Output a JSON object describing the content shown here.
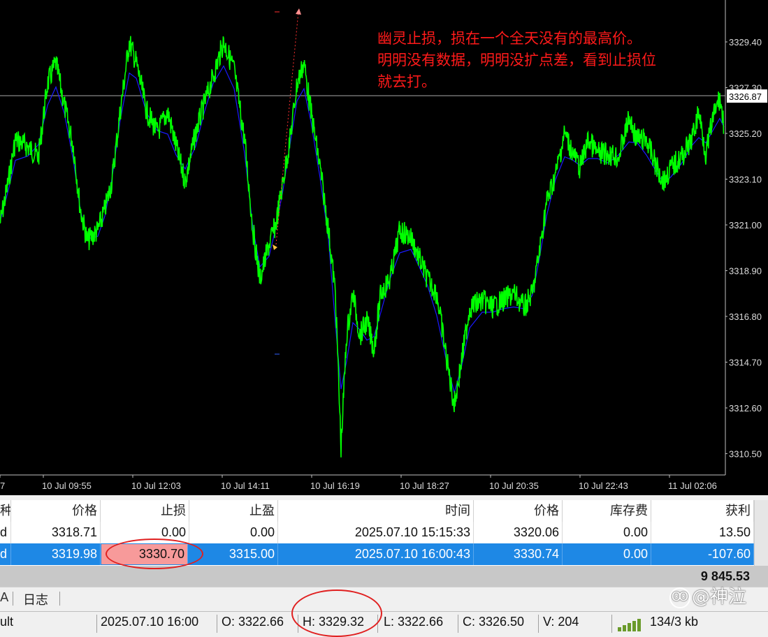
{
  "chart": {
    "annotation_lines": [
      "幽灵止损，损在一个全天没有的最高价。",
      "明明没有数据，明明没扩点差，看到止损位",
      "就去打。"
    ],
    "price_axis": [
      "3329.40",
      "3327.30",
      "3325.20",
      "3323.10",
      "3321.00",
      "3318.90",
      "3316.80",
      "3314.70",
      "3312.60",
      "3310.50"
    ],
    "current_price": "3326.87",
    "time_axis": [
      "7",
      "10 Jul 09:55",
      "10 Jul 12:03",
      "10 Jul 14:11",
      "10 Jul 16:19",
      "10 Jul 18:27",
      "10 Jul 20:35",
      "10 Jul 22:43",
      "11 Jul 02:06"
    ],
    "price_line_color": "#00ff00",
    "ma_line_color": "#1a1aff",
    "background_color": "#000000"
  },
  "orders_table": {
    "headers": [
      "种",
      "价格",
      "止损",
      "止盈",
      "时间",
      "价格",
      "库存费",
      "获利"
    ],
    "rows": [
      [
        "d",
        "3318.71",
        "0.00",
        "0.00",
        "2025.07.10 15:15:33",
        "3320.06",
        "0.00",
        "13.50"
      ],
      [
        "d",
        "3319.98",
        "3330.70",
        "3315.00",
        "2025.07.10 16:00:43",
        "3330.74",
        "0.00",
        "-107.60"
      ]
    ],
    "selected_row": 1,
    "balance": "9 845.53"
  },
  "tabs": {
    "first": "A",
    "journal": "日志"
  },
  "status_bar": {
    "profile": "ult",
    "time": "2025.07.10 16:00",
    "open": "O: 3322.66",
    "high": "H: 3329.32",
    "low": "L: 3322.66",
    "close": "C: 3326.50",
    "volume": "V: 204",
    "traffic": "134/3 kb"
  },
  "watermark": "@神泣"
}
